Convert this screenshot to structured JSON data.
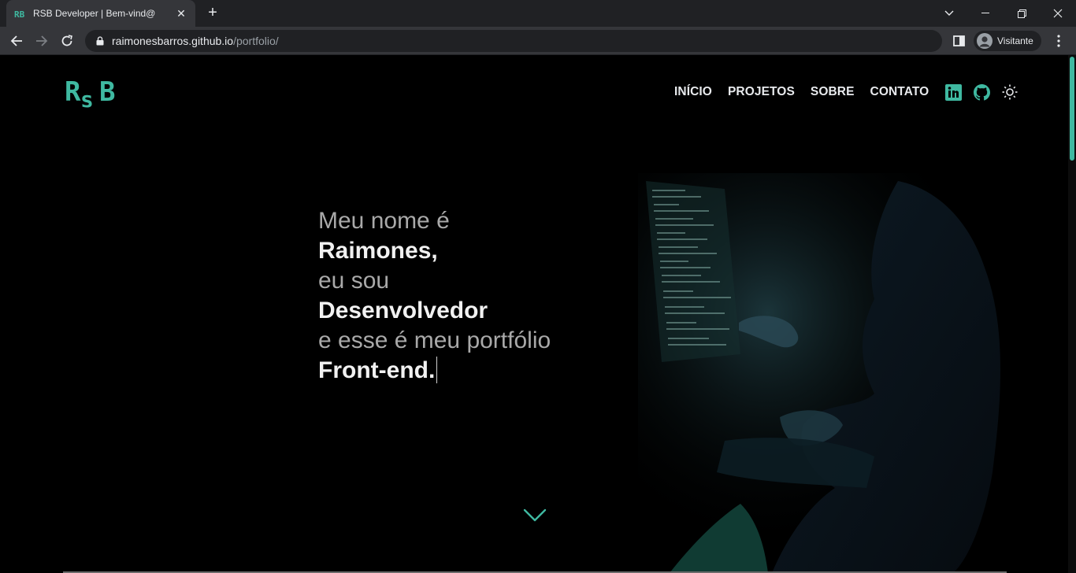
{
  "browser": {
    "tab_title": "RSB Developer | Bem-vind@",
    "url_host": "raimonesbarros.github.io",
    "url_path": "/portfolio/",
    "profile_label": "Visitante"
  },
  "site": {
    "logo_text": "RsB",
    "nav": [
      "INÍCIO",
      "PROJETOS",
      "SOBRE",
      "CONTATO"
    ],
    "accent_color": "#3fb9a1",
    "icons": [
      "linkedin-icon",
      "github-icon",
      "sun-icon"
    ]
  },
  "hero": {
    "line1": "Meu nome é",
    "line2": "Raimones,",
    "line3": "eu sou",
    "line4": "Desenvolvedor",
    "line5": "e esse é meu portfólio",
    "line6": "Front-end."
  }
}
